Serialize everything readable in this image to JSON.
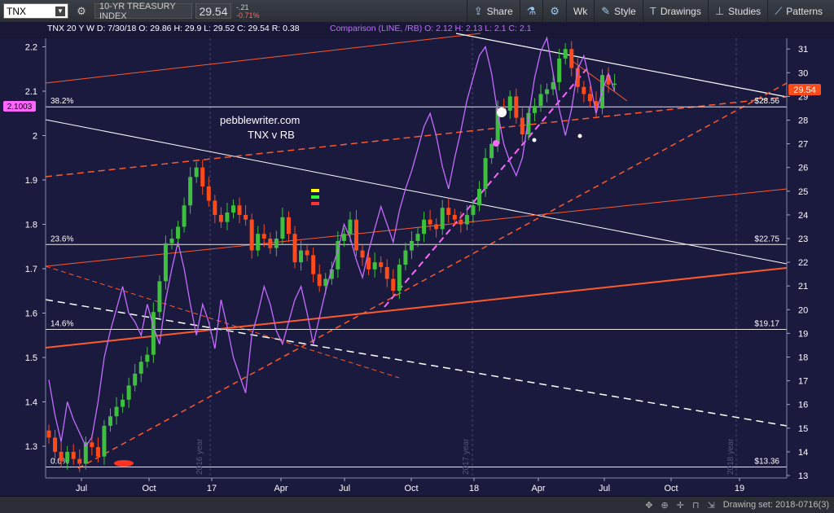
{
  "toolbar": {
    "symbol": "TNX",
    "description": "10-YR TREASURY INDEX",
    "last_price": "29.54",
    "change": "-.21",
    "change_pct": "-0.71%",
    "period": "Wk",
    "share_label": "Share",
    "style_label": "Style",
    "drawings_label": "Drawings",
    "studies_label": "Studies",
    "patterns_label": "Patterns"
  },
  "legend": {
    "ohlc": "TNX 20 Y W  D: 7/30/18  O: 29.86  H: 29.9  L: 29.52  C: 29.54  R: 0.38",
    "comparison": "Comparison (LINE, /RB)  O: 2.12  H: 2.13  L: 2.1  C: 2.1"
  },
  "annotations": {
    "site": "pebblewriter.com",
    "subtitle": "TNX v RB",
    "rb_marker": "2.1003",
    "price_marker": "29.54",
    "year_2016": "2016 year",
    "year_2017": "2017 year",
    "year_2018": "2018 year"
  },
  "status_bar": {
    "drawing_set": "Drawing set: 2018-0716(3)"
  },
  "colors": {
    "background": "#1a1a3e",
    "up_candle": "#3fbf3f",
    "down_candle": "#ff4a1a",
    "rb_line": "#c66cff",
    "trend_red": "#ff5a2a",
    "white_line": "#ffffff",
    "marker_magenta": "#ff66ff",
    "marker_red": "#ff4444"
  },
  "chart_data": {
    "type": "candlestick",
    "title": "TNX 20 Y W",
    "x_labels": [
      "Jul",
      "Oct",
      "17",
      "Apr",
      "Jul",
      "Oct",
      "18",
      "Apr",
      "Jul",
      "Oct",
      "19"
    ],
    "left_axis": {
      "label": "RB",
      "ticks": [
        1.3,
        1.4,
        1.5,
        1.6,
        1.7,
        1.8,
        1.9,
        2,
        2.1,
        2.2
      ],
      "ylim": [
        1.257,
        2.275
      ]
    },
    "right_axis": {
      "label": "TNX",
      "ticks": [
        13,
        14,
        15,
        16,
        17,
        18,
        19,
        20,
        21,
        22,
        23,
        24,
        25,
        26,
        27,
        28,
        29,
        30,
        31
      ],
      "ylim": [
        12.7,
        32.9
      ]
    },
    "fib_levels": [
      {
        "label": "0.0%",
        "price": "$13.36",
        "value": 13.36
      },
      {
        "label": "14.6%",
        "price": "$19.17",
        "value": 19.17
      },
      {
        "label": "23.6%",
        "price": "$22.75",
        "value": 22.75
      },
      {
        "label": "38.2%",
        "price": "$28.56",
        "value": 28.56
      }
    ],
    "tnx_weekly": {
      "description": "Weekly TNX candlesticks, Jun 2016 - Jul 2018",
      "close": [
        14.6,
        14.0,
        13.6,
        14.0,
        13.7,
        13.5,
        14.4,
        14.2,
        13.8,
        15.1,
        15.5,
        15.9,
        16.2,
        16.8,
        17.3,
        17.8,
        18.1,
        19.9,
        21.2,
        22.8,
        23.0,
        23.5,
        24.4,
        25.6,
        26.0,
        25.2,
        24.6,
        24.0,
        23.7,
        24.1,
        24.4,
        24.0,
        23.8,
        22.5,
        23.2,
        23.0,
        22.6,
        23.0,
        23.9,
        23.2,
        22.0,
        22.5,
        22.3,
        21.5,
        21.0,
        21.3,
        21.7,
        22.9,
        23.2,
        23.8,
        22.5,
        22.2,
        21.7,
        22.0,
        21.8,
        21.3,
        20.8,
        21.9,
        22.5,
        22.9,
        23.2,
        23.8,
        23.6,
        23.4,
        24.3,
        24.0,
        23.8,
        23.6,
        24.0,
        24.4,
        25.1,
        26.4,
        27.0,
        28.5,
        28.4,
        29.0,
        28.1,
        27.4,
        28.3,
        28.6,
        29.1,
        29.3,
        29.6,
        30.6,
        31.0,
        30.2,
        29.4,
        29.1,
        28.8,
        28.5,
        29.9,
        29.5,
        29.54
      ],
      "ohlc_last": {
        "date": "7/30/18",
        "open": 29.86,
        "high": 29.9,
        "low": 29.52,
        "close": 29.54
      }
    },
    "rb_comparison": {
      "name": "/RB",
      "type": "line",
      "values": [
        1.45,
        1.37,
        1.31,
        1.4,
        1.36,
        1.33,
        1.3,
        1.32,
        1.4,
        1.5,
        1.56,
        1.61,
        1.66,
        1.6,
        1.58,
        1.55,
        1.62,
        1.57,
        1.53,
        1.63,
        1.7,
        1.76,
        1.7,
        1.62,
        1.55,
        1.62,
        1.58,
        1.52,
        1.63,
        1.57,
        1.5,
        1.46,
        1.42,
        1.55,
        1.6,
        1.66,
        1.62,
        1.56,
        1.53,
        1.58,
        1.63,
        1.66,
        1.6,
        1.53,
        1.59,
        1.65,
        1.7,
        1.74,
        1.8,
        1.77,
        1.72,
        1.68,
        1.74,
        1.79,
        1.84,
        1.8,
        1.76,
        1.83,
        1.88,
        1.92,
        1.97,
        2.02,
        2.05,
        2.0,
        1.93,
        1.88,
        1.95,
        2.01,
        2.08,
        2.13,
        2.18,
        2.2,
        2.14,
        2.05,
        1.98,
        1.94,
        1.91,
        1.95,
        2.04,
        2.13,
        2.19,
        2.22,
        2.14,
        2.06,
        2.0,
        2.06,
        2.15,
        2.18,
        2.12,
        2.05,
        2.1,
        2.14,
        2.1003
      ]
    }
  }
}
